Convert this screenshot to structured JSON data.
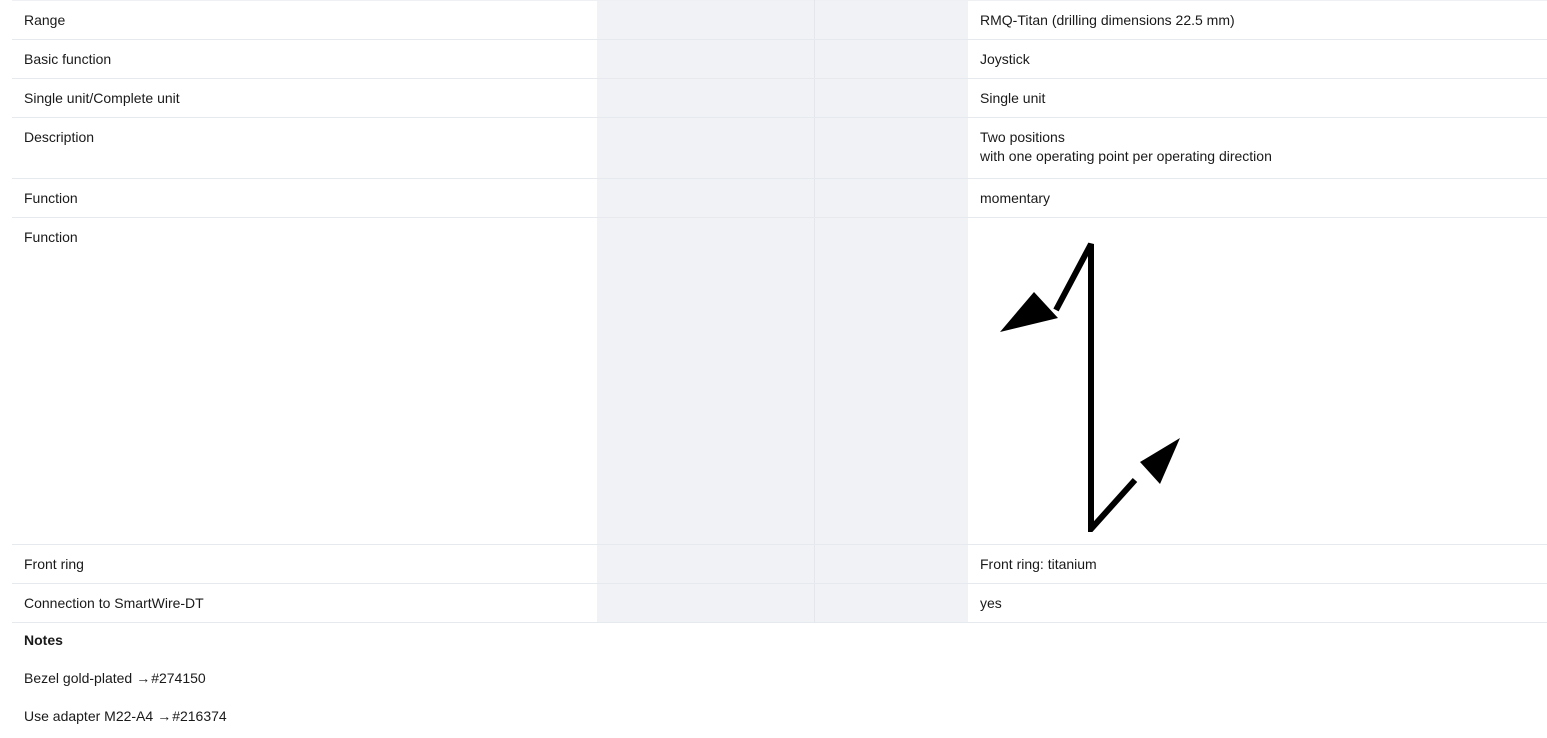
{
  "specs": [
    {
      "label": "Range",
      "value": [
        "RMQ-Titan (drilling dimensions 22.5 mm)"
      ]
    },
    {
      "label": "Basic function",
      "value": [
        "Joystick"
      ]
    },
    {
      "label": "Single unit/Complete unit",
      "value": [
        "Single unit"
      ]
    },
    {
      "label": "Description",
      "value": [
        "Two positions",
        "with one operating point per operating direction"
      ]
    },
    {
      "label": "Function",
      "value": [
        "momentary"
      ]
    },
    {
      "label": "Function",
      "icon": "joystick-two-position-momentary-icon"
    },
    {
      "label": "Front ring",
      "value": [
        "Front ring: titanium"
      ]
    },
    {
      "label": "Connection to SmartWire-DT",
      "value": [
        "yes"
      ]
    }
  ],
  "notes": {
    "title": "Notes",
    "items": [
      {
        "text": "Bezel gold-plated",
        "arrow": "→",
        "ref": "#274150"
      },
      {
        "text": "Use adapter M22-A4",
        "arrow": "→",
        "ref": "#216374"
      }
    ]
  }
}
